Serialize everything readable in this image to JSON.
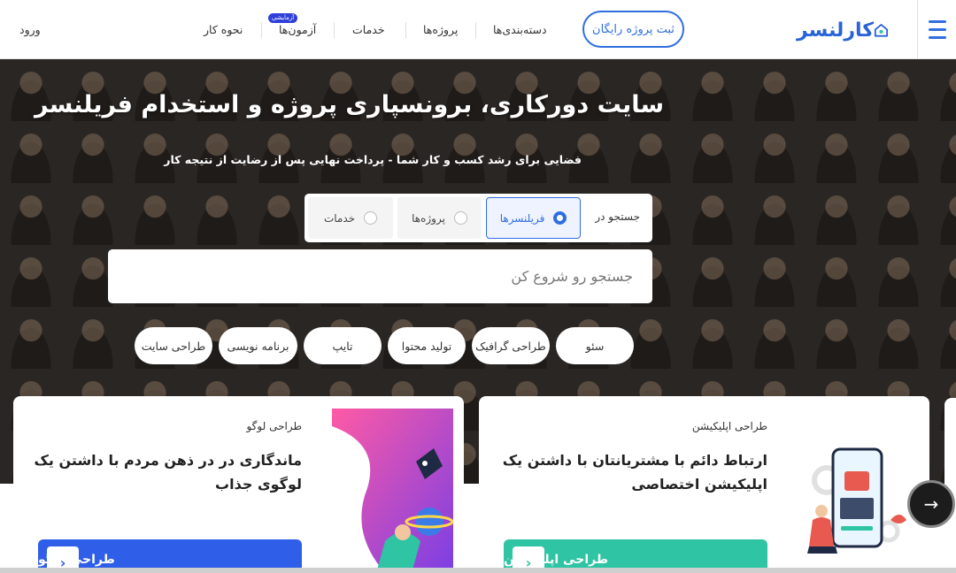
{
  "header": {
    "logo_text": "کارلنسر",
    "post_project_label": "ثبت پروژه رایگان",
    "nav": {
      "categories": "دسته‌بندی‌ها",
      "projects": "پروژه‌ها",
      "services": "خدمات",
      "tests": "آزمون‌ها",
      "tests_badge": "آزمایشی",
      "how_it_works": "نحوه کار",
      "login": "ورود"
    }
  },
  "hero": {
    "title": "سایت دورکاری، برونسپاری پروژه و استخدام فریلنسر",
    "subtitle": "فضایی برای رشد کسب و کار شما - پرداخت نهایی پس از رضایت از نتیجه کار",
    "search_in_label": "جستجو در",
    "search_tabs": [
      {
        "label": "فریلنسرها",
        "selected": true
      },
      {
        "label": "پروژه‌ها",
        "selected": false
      },
      {
        "label": "خدمات",
        "selected": false
      }
    ],
    "search_placeholder": "جستجو رو شروع کن",
    "chips": [
      "سئو",
      "طراحی گرافیک",
      "تولید محتوا",
      "تایپ",
      "برنامه نویسی",
      "طراحی سایت"
    ]
  },
  "cards": [
    {
      "tag": "طراحی اپلیکیشن",
      "title_line1": "ارتباط دائم با مشتریانتان با داشتن یک",
      "title_line2": "اپلیکیشن اختصاصی",
      "cta": "طراحی اپلیکیشن",
      "cta_color": "#2ec4a4"
    },
    {
      "tag": "طراحی لوگو",
      "title_line1": "ماندگاری در در ذهن مردم با داشتن یک",
      "title_line2": "لوگوی جذاب",
      "cta": "طراحی لوگو",
      "cta_color": "#2f5fe8"
    }
  ],
  "colors": {
    "brand_blue": "#2f6ee0",
    "teal": "#2ec4a4"
  },
  "icons": {
    "menu": "hamburger-icon",
    "next": "arrow-right-icon"
  }
}
